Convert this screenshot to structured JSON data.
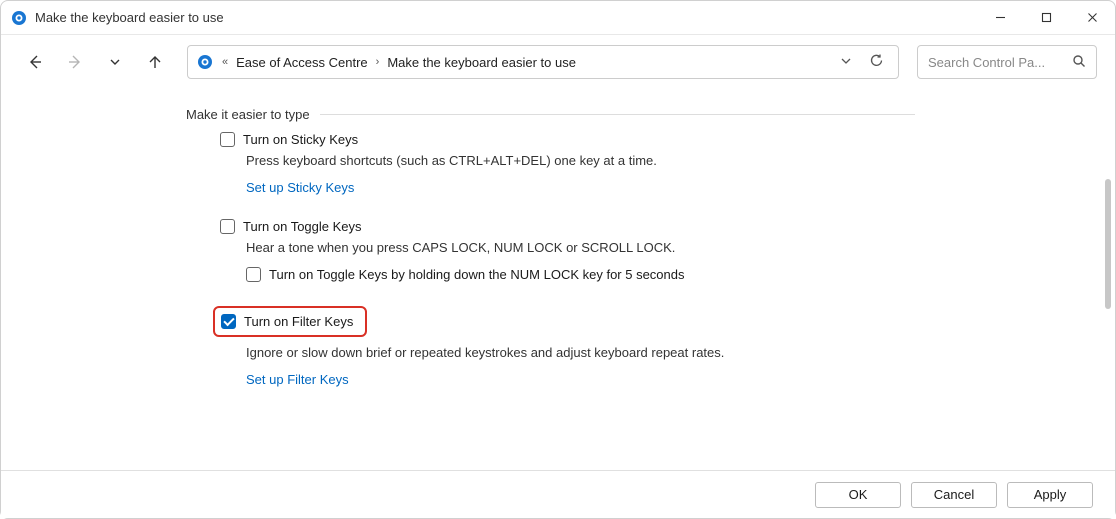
{
  "window": {
    "title": "Make the keyboard easier to use"
  },
  "breadcrumb": {
    "seg1": "Ease of Access Centre",
    "seg2": "Make the keyboard easier to use"
  },
  "search": {
    "placeholder": "Search Control Pa..."
  },
  "section": {
    "heading": "Make it easier to type",
    "sticky": {
      "label": "Turn on Sticky Keys",
      "checked": false,
      "desc": "Press keyboard shortcuts (such as CTRL+ALT+DEL) one key at a time.",
      "link": "Set up Sticky Keys"
    },
    "toggle": {
      "label": "Turn on Toggle Keys",
      "checked": false,
      "desc": "Hear a tone when you press CAPS LOCK, NUM LOCK or SCROLL LOCK.",
      "sub": {
        "label": "Turn on Toggle Keys by holding down the NUM LOCK key for 5 seconds",
        "checked": false
      }
    },
    "filter": {
      "label": "Turn on Filter Keys",
      "checked": true,
      "desc": "Ignore or slow down brief or repeated keystrokes and adjust keyboard repeat rates.",
      "link": "Set up Filter Keys"
    }
  },
  "buttons": {
    "ok": "OK",
    "cancel": "Cancel",
    "apply": "Apply"
  }
}
